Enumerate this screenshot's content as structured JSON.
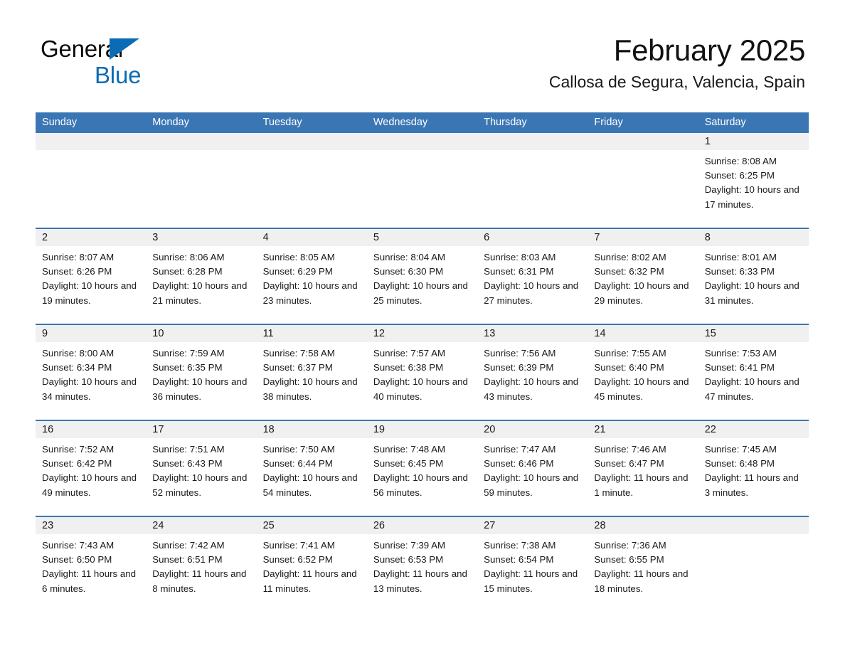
{
  "brand": {
    "logo_line1": "General",
    "logo_line2": "Blue",
    "logo_triangle_icon": "triangle-icon",
    "color_blue": "#0a6cb4"
  },
  "header": {
    "title": "February 2025",
    "subtitle": "Callosa de Segura, Valencia, Spain"
  },
  "theme": {
    "header_blue": "#3b76b4",
    "day_band_gray": "#f0f0f0",
    "text": "#1a1a1a"
  },
  "weekdays": [
    "Sunday",
    "Monday",
    "Tuesday",
    "Wednesday",
    "Thursday",
    "Friday",
    "Saturday"
  ],
  "weeks": [
    [
      {
        "day": "",
        "sunrise": "",
        "sunset": "",
        "daylight": "",
        "empty": true
      },
      {
        "day": "",
        "sunrise": "",
        "sunset": "",
        "daylight": "",
        "empty": true
      },
      {
        "day": "",
        "sunrise": "",
        "sunset": "",
        "daylight": "",
        "empty": true
      },
      {
        "day": "",
        "sunrise": "",
        "sunset": "",
        "daylight": "",
        "empty": true
      },
      {
        "day": "",
        "sunrise": "",
        "sunset": "",
        "daylight": "",
        "empty": true
      },
      {
        "day": "",
        "sunrise": "",
        "sunset": "",
        "daylight": "",
        "empty": true
      },
      {
        "day": "1",
        "sunrise": "Sunrise: 8:08 AM",
        "sunset": "Sunset: 6:25 PM",
        "daylight": "Daylight: 10 hours and 17 minutes.",
        "empty": false
      }
    ],
    [
      {
        "day": "2",
        "sunrise": "Sunrise: 8:07 AM",
        "sunset": "Sunset: 6:26 PM",
        "daylight": "Daylight: 10 hours and 19 minutes.",
        "empty": false
      },
      {
        "day": "3",
        "sunrise": "Sunrise: 8:06 AM",
        "sunset": "Sunset: 6:28 PM",
        "daylight": "Daylight: 10 hours and 21 minutes.",
        "empty": false
      },
      {
        "day": "4",
        "sunrise": "Sunrise: 8:05 AM",
        "sunset": "Sunset: 6:29 PM",
        "daylight": "Daylight: 10 hours and 23 minutes.",
        "empty": false
      },
      {
        "day": "5",
        "sunrise": "Sunrise: 8:04 AM",
        "sunset": "Sunset: 6:30 PM",
        "daylight": "Daylight: 10 hours and 25 minutes.",
        "empty": false
      },
      {
        "day": "6",
        "sunrise": "Sunrise: 8:03 AM",
        "sunset": "Sunset: 6:31 PM",
        "daylight": "Daylight: 10 hours and 27 minutes.",
        "empty": false
      },
      {
        "day": "7",
        "sunrise": "Sunrise: 8:02 AM",
        "sunset": "Sunset: 6:32 PM",
        "daylight": "Daylight: 10 hours and 29 minutes.",
        "empty": false
      },
      {
        "day": "8",
        "sunrise": "Sunrise: 8:01 AM",
        "sunset": "Sunset: 6:33 PM",
        "daylight": "Daylight: 10 hours and 31 minutes.",
        "empty": false
      }
    ],
    [
      {
        "day": "9",
        "sunrise": "Sunrise: 8:00 AM",
        "sunset": "Sunset: 6:34 PM",
        "daylight": "Daylight: 10 hours and 34 minutes.",
        "empty": false
      },
      {
        "day": "10",
        "sunrise": "Sunrise: 7:59 AM",
        "sunset": "Sunset: 6:35 PM",
        "daylight": "Daylight: 10 hours and 36 minutes.",
        "empty": false
      },
      {
        "day": "11",
        "sunrise": "Sunrise: 7:58 AM",
        "sunset": "Sunset: 6:37 PM",
        "daylight": "Daylight: 10 hours and 38 minutes.",
        "empty": false
      },
      {
        "day": "12",
        "sunrise": "Sunrise: 7:57 AM",
        "sunset": "Sunset: 6:38 PM",
        "daylight": "Daylight: 10 hours and 40 minutes.",
        "empty": false
      },
      {
        "day": "13",
        "sunrise": "Sunrise: 7:56 AM",
        "sunset": "Sunset: 6:39 PM",
        "daylight": "Daylight: 10 hours and 43 minutes.",
        "empty": false
      },
      {
        "day": "14",
        "sunrise": "Sunrise: 7:55 AM",
        "sunset": "Sunset: 6:40 PM",
        "daylight": "Daylight: 10 hours and 45 minutes.",
        "empty": false
      },
      {
        "day": "15",
        "sunrise": "Sunrise: 7:53 AM",
        "sunset": "Sunset: 6:41 PM",
        "daylight": "Daylight: 10 hours and 47 minutes.",
        "empty": false
      }
    ],
    [
      {
        "day": "16",
        "sunrise": "Sunrise: 7:52 AM",
        "sunset": "Sunset: 6:42 PM",
        "daylight": "Daylight: 10 hours and 49 minutes.",
        "empty": false
      },
      {
        "day": "17",
        "sunrise": "Sunrise: 7:51 AM",
        "sunset": "Sunset: 6:43 PM",
        "daylight": "Daylight: 10 hours and 52 minutes.",
        "empty": false
      },
      {
        "day": "18",
        "sunrise": "Sunrise: 7:50 AM",
        "sunset": "Sunset: 6:44 PM",
        "daylight": "Daylight: 10 hours and 54 minutes.",
        "empty": false
      },
      {
        "day": "19",
        "sunrise": "Sunrise: 7:48 AM",
        "sunset": "Sunset: 6:45 PM",
        "daylight": "Daylight: 10 hours and 56 minutes.",
        "empty": false
      },
      {
        "day": "20",
        "sunrise": "Sunrise: 7:47 AM",
        "sunset": "Sunset: 6:46 PM",
        "daylight": "Daylight: 10 hours and 59 minutes.",
        "empty": false
      },
      {
        "day": "21",
        "sunrise": "Sunrise: 7:46 AM",
        "sunset": "Sunset: 6:47 PM",
        "daylight": "Daylight: 11 hours and 1 minute.",
        "empty": false
      },
      {
        "day": "22",
        "sunrise": "Sunrise: 7:45 AM",
        "sunset": "Sunset: 6:48 PM",
        "daylight": "Daylight: 11 hours and 3 minutes.",
        "empty": false
      }
    ],
    [
      {
        "day": "23",
        "sunrise": "Sunrise: 7:43 AM",
        "sunset": "Sunset: 6:50 PM",
        "daylight": "Daylight: 11 hours and 6 minutes.",
        "empty": false
      },
      {
        "day": "24",
        "sunrise": "Sunrise: 7:42 AM",
        "sunset": "Sunset: 6:51 PM",
        "daylight": "Daylight: 11 hours and 8 minutes.",
        "empty": false
      },
      {
        "day": "25",
        "sunrise": "Sunrise: 7:41 AM",
        "sunset": "Sunset: 6:52 PM",
        "daylight": "Daylight: 11 hours and 11 minutes.",
        "empty": false
      },
      {
        "day": "26",
        "sunrise": "Sunrise: 7:39 AM",
        "sunset": "Sunset: 6:53 PM",
        "daylight": "Daylight: 11 hours and 13 minutes.",
        "empty": false
      },
      {
        "day": "27",
        "sunrise": "Sunrise: 7:38 AM",
        "sunset": "Sunset: 6:54 PM",
        "daylight": "Daylight: 11 hours and 15 minutes.",
        "empty": false
      },
      {
        "day": "28",
        "sunrise": "Sunrise: 7:36 AM",
        "sunset": "Sunset: 6:55 PM",
        "daylight": "Daylight: 11 hours and 18 minutes.",
        "empty": false
      },
      {
        "day": "",
        "sunrise": "",
        "sunset": "",
        "daylight": "",
        "empty": true
      }
    ]
  ]
}
